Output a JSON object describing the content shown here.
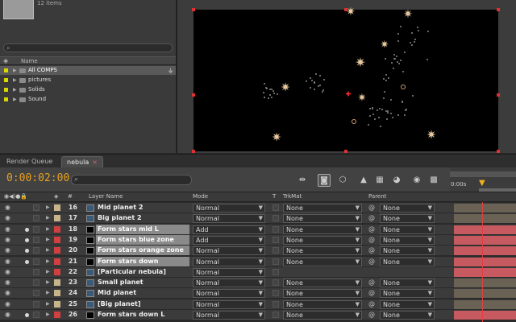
{
  "project": {
    "item_count": "12 items",
    "name_header": "Name",
    "items": [
      {
        "name": "All COMPS",
        "selected": true
      },
      {
        "name": "pictures",
        "selected": false
      },
      {
        "name": "Solids",
        "selected": false
      },
      {
        "name": "Sound",
        "selected": false
      }
    ]
  },
  "tabs": {
    "render_queue": "Render Queue",
    "nebula": "nebula",
    "close": "×"
  },
  "timeline": {
    "timecode": "0:00:02:00",
    "ruler_start": "0:00s",
    "columns": {
      "num": "#",
      "layer_name": "Layer Name",
      "mode": "Mode",
      "t": "T",
      "trkmat": "TrkMat",
      "parent": "Parent"
    },
    "layers": [
      {
        "num": "16",
        "name": "Mid planet 2",
        "mode": "Normal",
        "trkmat": "None",
        "parent": "None",
        "label_color": "#c8b48a",
        "bar_color": "#6b6256",
        "highlight": false,
        "solo": false
      },
      {
        "num": "17",
        "name": "Big planet 2",
        "mode": "Normal",
        "trkmat": "None",
        "parent": "None",
        "label_color": "#c8b48a",
        "bar_color": "#6b6256",
        "highlight": false,
        "solo": false
      },
      {
        "num": "18",
        "name": "Form stars mid L",
        "mode": "Add",
        "trkmat": "None",
        "parent": "None",
        "label_color": "#d04040",
        "bar_color": "#c65a60",
        "highlight": true,
        "solo": true
      },
      {
        "num": "19",
        "name": "Form stars blue zone",
        "mode": "Add",
        "trkmat": "None",
        "parent": "None",
        "label_color": "#d04040",
        "bar_color": "#c65a60",
        "highlight": true,
        "solo": true
      },
      {
        "num": "20",
        "name": "Form stars orange zone",
        "mode": "Normal",
        "trkmat": "None",
        "parent": "None",
        "label_color": "#d04040",
        "bar_color": "#c65a60",
        "highlight": true,
        "solo": true
      },
      {
        "num": "21",
        "name": "Form stars down",
        "mode": "Normal",
        "trkmat": "None",
        "parent": "None",
        "label_color": "#d04040",
        "bar_color": "#c65a60",
        "highlight": true,
        "solo": true
      },
      {
        "num": "22",
        "name": "[Particular nebula]",
        "mode": "Normal",
        "trkmat": "",
        "parent": "",
        "label_color": "#d04040",
        "bar_color": "#c65a60",
        "highlight": false,
        "solo": false
      },
      {
        "num": "23",
        "name": "Small planet",
        "mode": "Normal",
        "trkmat": "None",
        "parent": "None",
        "label_color": "#c8b48a",
        "bar_color": "#6b6256",
        "highlight": false,
        "solo": false
      },
      {
        "num": "24",
        "name": "Mid planet",
        "mode": "Normal",
        "trkmat": "None",
        "parent": "None",
        "label_color": "#c8b48a",
        "bar_color": "#6b6256",
        "highlight": false,
        "solo": false
      },
      {
        "num": "25",
        "name": "[Big planet]",
        "mode": "Normal",
        "trkmat": "None",
        "parent": "None",
        "label_color": "#c8b48a",
        "bar_color": "#6b6256",
        "highlight": false,
        "solo": false
      },
      {
        "num": "26",
        "name": "Form stars down  L",
        "mode": "Normal",
        "trkmat": "None",
        "parent": "None",
        "label_color": "#d04040",
        "bar_color": "#c65a60",
        "highlight": false,
        "solo": true
      }
    ]
  }
}
